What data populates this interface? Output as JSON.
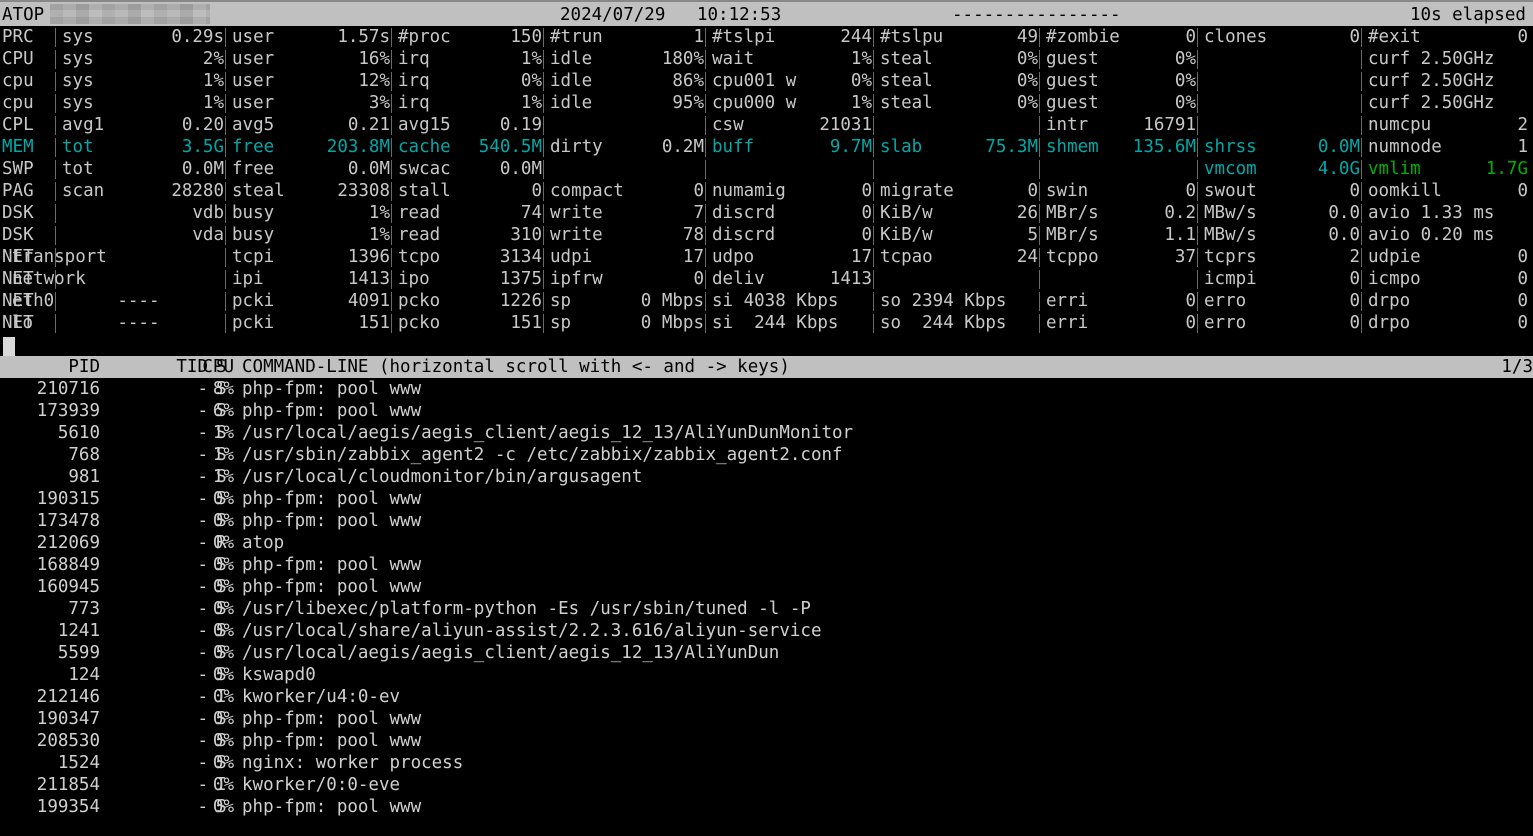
{
  "titlebar": {
    "app": "ATOP -",
    "host_redacted": "",
    "date": "2024/07/29",
    "time": "10:12:53",
    "dashes": "----------------",
    "elapsed": "10s elapsed"
  },
  "sysrows": [
    {
      "label": "PRC",
      "color": "grey",
      "cells": [
        {
          "k": "sys",
          "v": "0.29s"
        },
        {
          "k": "user",
          "v": "1.57s"
        },
        {
          "k": "#proc",
          "v": "150"
        },
        {
          "k": "#trun",
          "v": "1"
        },
        {
          "k": "#tslpi",
          "v": "244"
        },
        {
          "k": "#tslpu",
          "v": "49"
        },
        {
          "k": "#zombie",
          "v": "0"
        },
        {
          "k": "clones",
          "v": "0"
        },
        {
          "k": "#exit",
          "v": "0"
        }
      ]
    },
    {
      "label": "CPU",
      "color": "grey",
      "cells": [
        {
          "k": "sys",
          "v": "2%"
        },
        {
          "k": "user",
          "v": "16%"
        },
        {
          "k": "irq",
          "v": "1%"
        },
        {
          "k": "idle",
          "v": "180%"
        },
        {
          "k": "wait",
          "v": "1%"
        },
        {
          "k": "steal",
          "v": "0%"
        },
        {
          "k": "guest",
          "v": "0%"
        },
        {
          "k": "",
          "v": ""
        },
        {
          "k": "curf 2.50GHz",
          "v": ""
        }
      ]
    },
    {
      "label": "cpu",
      "color": "grey",
      "cells": [
        {
          "k": "sys",
          "v": "1%"
        },
        {
          "k": "user",
          "v": "12%"
        },
        {
          "k": "irq",
          "v": "0%"
        },
        {
          "k": "idle",
          "v": "86%"
        },
        {
          "k": "cpu001 w",
          "v": "0%"
        },
        {
          "k": "steal",
          "v": "0%"
        },
        {
          "k": "guest",
          "v": "0%"
        },
        {
          "k": "",
          "v": ""
        },
        {
          "k": "curf 2.50GHz",
          "v": ""
        }
      ]
    },
    {
      "label": "cpu",
      "color": "grey",
      "cells": [
        {
          "k": "sys",
          "v": "1%"
        },
        {
          "k": "user",
          "v": "3%"
        },
        {
          "k": "irq",
          "v": "1%"
        },
        {
          "k": "idle",
          "v": "95%"
        },
        {
          "k": "cpu000 w",
          "v": "1%"
        },
        {
          "k": "steal",
          "v": "0%"
        },
        {
          "k": "guest",
          "v": "0%"
        },
        {
          "k": "",
          "v": ""
        },
        {
          "k": "curf 2.50GHz",
          "v": ""
        }
      ]
    },
    {
      "label": "CPL",
      "color": "grey",
      "cells": [
        {
          "k": "avg1",
          "v": "0.20"
        },
        {
          "k": "avg5",
          "v": "0.21"
        },
        {
          "k": "avg15",
          "v": "0.19"
        },
        {
          "k": "",
          "v": ""
        },
        {
          "k": "csw",
          "v": "21031"
        },
        {
          "k": "",
          "v": ""
        },
        {
          "k": "intr",
          "v": "16791"
        },
        {
          "k": "",
          "v": ""
        },
        {
          "k": "numcpu",
          "v": "2"
        }
      ]
    },
    {
      "label": "MEM",
      "color": "teal",
      "cells": [
        {
          "k": "tot",
          "v": "3.5G"
        },
        {
          "k": "free",
          "v": "203.8M"
        },
        {
          "k": "cache",
          "v": "540.5M"
        },
        {
          "k": "dirty",
          "v": "0.2M",
          "color": "grey"
        },
        {
          "k": "buff",
          "v": "9.7M"
        },
        {
          "k": "slab",
          "v": "75.3M"
        },
        {
          "k": "shmem",
          "v": "135.6M"
        },
        {
          "k": "shrss",
          "v": "0.0M"
        },
        {
          "k": "numnode",
          "v": "1",
          "color": "grey"
        }
      ]
    },
    {
      "label": "SWP",
      "color": "grey",
      "cells": [
        {
          "k": "tot",
          "v": "0.0M"
        },
        {
          "k": "free",
          "v": "0.0M"
        },
        {
          "k": "swcac",
          "v": "0.0M"
        },
        {
          "k": "",
          "v": ""
        },
        {
          "k": "",
          "v": ""
        },
        {
          "k": "",
          "v": ""
        },
        {
          "k": "",
          "v": ""
        },
        {
          "k": "vmcom",
          "v": "4.0G",
          "color": "teal"
        },
        {
          "k": "vmlim",
          "v": "1.7G",
          "color": "green"
        }
      ]
    },
    {
      "label": "PAG",
      "color": "grey",
      "cells": [
        {
          "k": "scan",
          "v": "28280"
        },
        {
          "k": "steal",
          "v": "23308"
        },
        {
          "k": "stall",
          "v": "0"
        },
        {
          "k": "compact",
          "v": "0"
        },
        {
          "k": "numamig",
          "v": "0"
        },
        {
          "k": "migrate",
          "v": "0"
        },
        {
          "k": "swin",
          "v": "0"
        },
        {
          "k": "swout",
          "v": "0"
        },
        {
          "k": "oomkill",
          "v": "0"
        }
      ]
    },
    {
      "label": "DSK",
      "color": "grey",
      "cells": [
        {
          "k": "",
          "v": "vdb"
        },
        {
          "k": "busy",
          "v": "1%"
        },
        {
          "k": "read",
          "v": "74"
        },
        {
          "k": "write",
          "v": "7"
        },
        {
          "k": "discrd",
          "v": "0"
        },
        {
          "k": "KiB/w",
          "v": "26"
        },
        {
          "k": "MBr/s",
          "v": "0.2"
        },
        {
          "k": "MBw/s",
          "v": "0.0"
        },
        {
          "k": "avio 1.33 ms",
          "v": ""
        }
      ]
    },
    {
      "label": "DSK",
      "color": "grey",
      "cells": [
        {
          "k": "",
          "v": "vda"
        },
        {
          "k": "busy",
          "v": "1%"
        },
        {
          "k": "read",
          "v": "310"
        },
        {
          "k": "write",
          "v": "78"
        },
        {
          "k": "discrd",
          "v": "0"
        },
        {
          "k": "KiB/w",
          "v": "5"
        },
        {
          "k": "MBr/s",
          "v": "1.1"
        },
        {
          "k": "MBw/s",
          "v": "0.0"
        },
        {
          "k": "avio 0.20 ms",
          "v": ""
        }
      ]
    },
    {
      "label": "NET",
      "color": "grey",
      "cells": [
        {
          "k": "transport",
          "v": "",
          "align": "left"
        },
        {
          "k": "tcpi",
          "v": "1396"
        },
        {
          "k": "tcpo",
          "v": "3134"
        },
        {
          "k": "udpi",
          "v": "17"
        },
        {
          "k": "udpo",
          "v": "17"
        },
        {
          "k": "tcpao",
          "v": "24"
        },
        {
          "k": "tcppo",
          "v": "37"
        },
        {
          "k": "tcprs",
          "v": "2"
        },
        {
          "k": "udpie",
          "v": "0"
        }
      ]
    },
    {
      "label": "NET",
      "color": "grey",
      "cells": [
        {
          "k": "network",
          "v": "",
          "align": "left"
        },
        {
          "k": "ipi",
          "v": "1413"
        },
        {
          "k": "ipo",
          "v": "1375"
        },
        {
          "k": "ipfrw",
          "v": "0"
        },
        {
          "k": "deliv",
          "v": "1413"
        },
        {
          "k": "",
          "v": ""
        },
        {
          "k": "",
          "v": ""
        },
        {
          "k": "icmpi",
          "v": "0"
        },
        {
          "k": "icmpo",
          "v": "0"
        }
      ]
    },
    {
      "label": "NET",
      "color": "grey",
      "cells": [
        {
          "k": "eth0      ----",
          "v": "",
          "align": "left"
        },
        {
          "k": "pcki",
          "v": "4091"
        },
        {
          "k": "pcko",
          "v": "1226"
        },
        {
          "k": "sp",
          "v": "0 Mbps"
        },
        {
          "k": "si 4038 Kbps",
          "v": ""
        },
        {
          "k": "so 2394 Kbps",
          "v": ""
        },
        {
          "k": "erri",
          "v": "0"
        },
        {
          "k": "erro",
          "v": "0"
        },
        {
          "k": "drpo",
          "v": "0"
        }
      ]
    },
    {
      "label": "NET",
      "color": "grey",
      "cells": [
        {
          "k": "lo        ----",
          "v": "",
          "align": "left"
        },
        {
          "k": "pcki",
          "v": "151"
        },
        {
          "k": "pcko",
          "v": "151"
        },
        {
          "k": "sp",
          "v": "0 Mbps"
        },
        {
          "k": "si  244 Kbps",
          "v": ""
        },
        {
          "k": "so  244 Kbps",
          "v": ""
        },
        {
          "k": "erri",
          "v": "0"
        },
        {
          "k": "erro",
          "v": "0"
        },
        {
          "k": "drpo",
          "v": "0"
        }
      ]
    }
  ],
  "process_header": {
    "pid": "PID",
    "tid": "TID",
    "state": "S",
    "cpu": "CPU",
    "command": "COMMAND-LINE (horizontal scroll with <- and -> keys)",
    "page": "1/3"
  },
  "processes": [
    {
      "pid": "210716",
      "tid": "-",
      "state": "S",
      "cpu": "8%",
      "cmd": "php-fpm: pool www"
    },
    {
      "pid": "173939",
      "tid": "-",
      "state": "S",
      "cpu": "6%",
      "cmd": "php-fpm: pool www"
    },
    {
      "pid": "5610",
      "tid": "-",
      "state": "S",
      "cpu": "1%",
      "cmd": "/usr/local/aegis/aegis_client/aegis_12_13/AliYunDunMonitor"
    },
    {
      "pid": "768",
      "tid": "-",
      "state": "S",
      "cpu": "1%",
      "cmd": "/usr/sbin/zabbix_agent2 -c /etc/zabbix/zabbix_agent2.conf"
    },
    {
      "pid": "981",
      "tid": "-",
      "state": "S",
      "cpu": "1%",
      "cmd": "/usr/local/cloudmonitor/bin/argusagent"
    },
    {
      "pid": "190315",
      "tid": "-",
      "state": "S",
      "cpu": "0%",
      "cmd": "php-fpm: pool www"
    },
    {
      "pid": "173478",
      "tid": "-",
      "state": "S",
      "cpu": "0%",
      "cmd": "php-fpm: pool www"
    },
    {
      "pid": "212069",
      "tid": "-",
      "state": "R",
      "cpu": "0%",
      "cmd": "atop"
    },
    {
      "pid": "168849",
      "tid": "-",
      "state": "S",
      "cpu": "0%",
      "cmd": "php-fpm: pool www"
    },
    {
      "pid": "160945",
      "tid": "-",
      "state": "S",
      "cpu": "0%",
      "cmd": "php-fpm: pool www"
    },
    {
      "pid": "773",
      "tid": "-",
      "state": "S",
      "cpu": "0%",
      "cmd": "/usr/libexec/platform-python -Es /usr/sbin/tuned -l -P"
    },
    {
      "pid": "1241",
      "tid": "-",
      "state": "S",
      "cpu": "0%",
      "cmd": "/usr/local/share/aliyun-assist/2.2.3.616/aliyun-service"
    },
    {
      "pid": "5599",
      "tid": "-",
      "state": "S",
      "cpu": "0%",
      "cmd": "/usr/local/aegis/aegis_client/aegis_12_13/AliYunDun"
    },
    {
      "pid": "124",
      "tid": "-",
      "state": "S",
      "cpu": "0%",
      "cmd": "kswapd0"
    },
    {
      "pid": "212146",
      "tid": "-",
      "state": "I",
      "cpu": "0%",
      "cmd": "kworker/u4:0-ev"
    },
    {
      "pid": "190347",
      "tid": "-",
      "state": "S",
      "cpu": "0%",
      "cmd": "php-fpm: pool www"
    },
    {
      "pid": "208530",
      "tid": "-",
      "state": "S",
      "cpu": "0%",
      "cmd": "php-fpm: pool www"
    },
    {
      "pid": "1524",
      "tid": "-",
      "state": "S",
      "cpu": "0%",
      "cmd": "nginx: worker process"
    },
    {
      "pid": "211854",
      "tid": "-",
      "state": "I",
      "cpu": "0%",
      "cmd": "kworker/0:0-eve"
    },
    {
      "pid": "199354",
      "tid": "-",
      "state": "S",
      "cpu": "0%",
      "cmd": "php-fpm: pool www"
    }
  ],
  "colors": {
    "background": "#000000",
    "foreground": "#c8c8c8",
    "bar_background": "#c0c0c0",
    "bar_foreground": "#000000",
    "teal": "#00a8a8",
    "green": "#00b000",
    "separator": "#6a6a6a"
  }
}
